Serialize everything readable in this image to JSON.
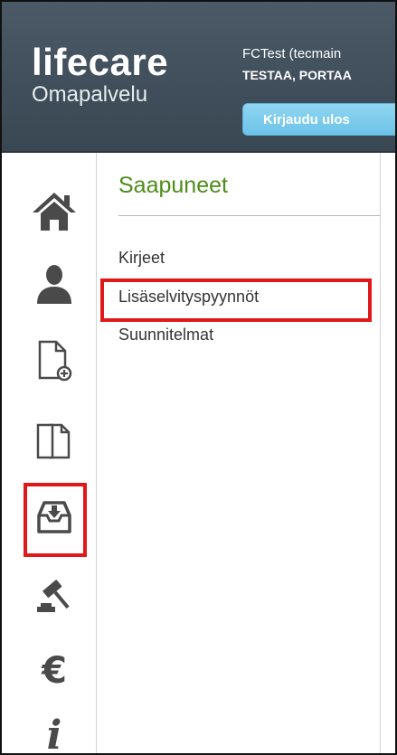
{
  "header": {
    "logo_main": "lifecare",
    "logo_sub": "Omapalvelu",
    "user_name": "FCTest (tecmain",
    "user_org": "TESTAA, PORTAA",
    "logout_label": "Kirjaudu ulos"
  },
  "sidebar": {
    "items": [
      {
        "icon": "home-icon"
      },
      {
        "icon": "user-icon"
      },
      {
        "icon": "new-document-icon"
      },
      {
        "icon": "documents-icon"
      },
      {
        "icon": "inbox-icon",
        "selected": true
      },
      {
        "icon": "gavel-icon"
      },
      {
        "icon": "euro-icon",
        "glyph": "€"
      },
      {
        "icon": "info-icon",
        "glyph": "i"
      }
    ]
  },
  "main": {
    "section_title": "Saapuneet",
    "links": [
      {
        "label": "Kirjeet"
      },
      {
        "label": "Lisäselvityspyynnöt",
        "highlighted": true
      },
      {
        "label": "Suunnitelmat"
      }
    ]
  },
  "colors": {
    "header_bg": "#404f5b",
    "accent_green": "#4c8d1a",
    "logout_blue": "#7ccbec",
    "highlight_red": "#e01818",
    "icon_gray": "#4a4a4a"
  }
}
